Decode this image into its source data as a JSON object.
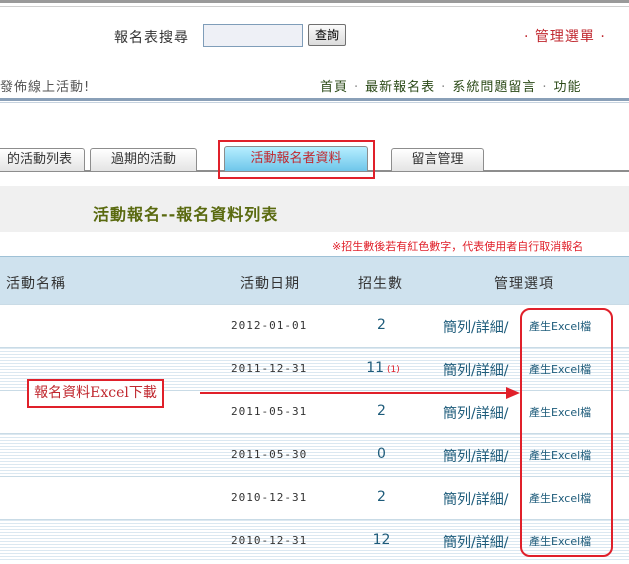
{
  "header": {
    "search_label": "報名表搜尋",
    "search_value": "",
    "search_button": "查詢",
    "admin_menu": "· 管理選單 ·"
  },
  "banner": {
    "text": "發佈線上活動!"
  },
  "nav": {
    "items": [
      "首頁",
      "最新報名表",
      "系統問題留言",
      "功能"
    ]
  },
  "tabs": [
    {
      "label": "的活動列表"
    },
    {
      "label": "過期的活動"
    },
    {
      "label": "活動報名者資料"
    },
    {
      "label": "留言管理"
    }
  ],
  "page": {
    "title": "活動報名--報名資料列表",
    "note": "※招生數後若有紅色數字，代表使用者自行取消報名"
  },
  "table": {
    "columns": [
      "活動名稱",
      "活動日期",
      "招生數",
      "管理選項"
    ],
    "rows": [
      {
        "date": "2012-01-01",
        "count": "2",
        "cancel": "",
        "link": "簡列/詳細/",
        "excel": "產生Excel檔"
      },
      {
        "date": "2011-12-31",
        "count": "11",
        "cancel": "(1)",
        "link": "簡列/詳細/",
        "excel": "產生Excel檔"
      },
      {
        "date": "2011-05-31",
        "count": "2",
        "cancel": "",
        "link": "簡列/詳細/",
        "excel": "產生Excel檔"
      },
      {
        "date": "2011-05-30",
        "count": "0",
        "cancel": "",
        "link": "簡列/詳細/",
        "excel": "產生Excel檔"
      },
      {
        "date": "2010-12-31",
        "count": "2",
        "cancel": "",
        "link": "簡列/詳細/",
        "excel": "產生Excel檔"
      },
      {
        "date": "2010-12-31",
        "count": "12",
        "cancel": "",
        "link": "簡列/詳細/",
        "excel": "產生Excel檔"
      }
    ]
  },
  "annotation": {
    "label": "報名資料Excel下載",
    "color": "#e0202a"
  }
}
